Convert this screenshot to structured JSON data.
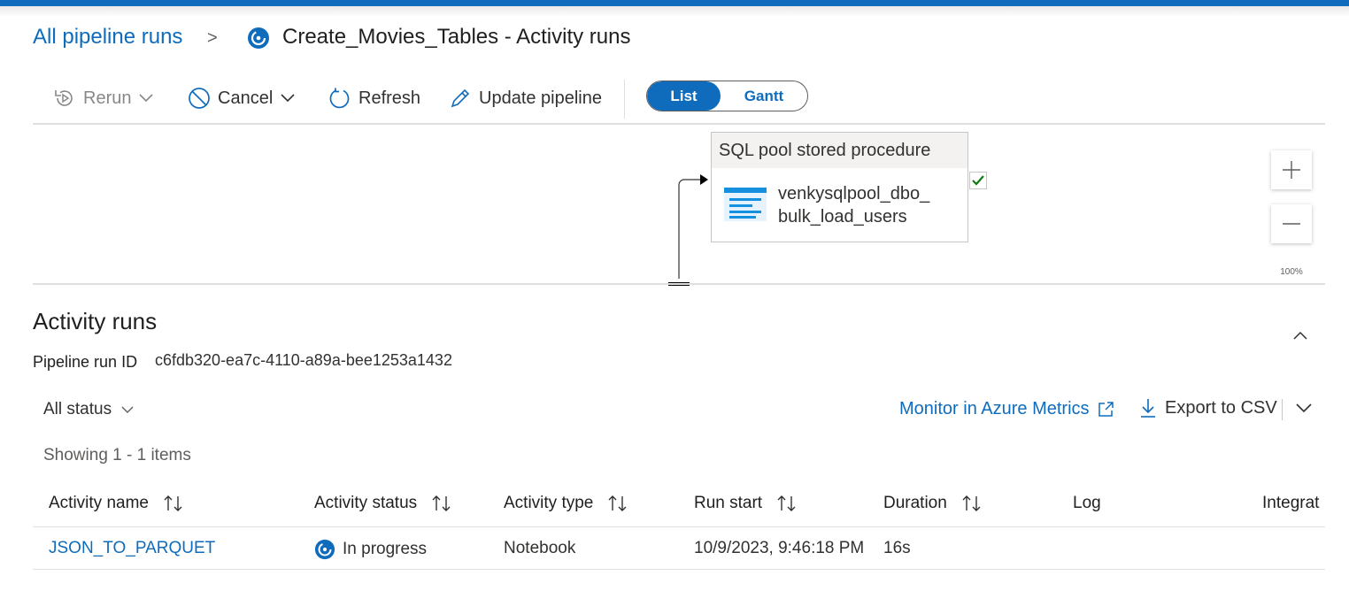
{
  "breadcrumb": {
    "root_link": "All pipeline runs",
    "separator": ">",
    "title": "Create_Movies_Tables - Activity runs",
    "status_icon": "in-progress-icon"
  },
  "toolbar": {
    "rerun_label": "Rerun",
    "cancel_label": "Cancel",
    "refresh_label": "Refresh",
    "update_label": "Update pipeline",
    "view_options": [
      "List",
      "Gantt"
    ],
    "selected_view": "List"
  },
  "canvas": {
    "activity_type_label": "SQL pool stored procedure",
    "activity_name_line1": "venkysqlpool_dbo_",
    "activity_name_line2": "bulk_load_users",
    "status": "succeeded",
    "zoom_fit_label": "100%"
  },
  "activity_runs": {
    "title": "Activity runs",
    "run_id_label": "Pipeline run ID",
    "run_id_value": "c6fdb320-ea7c-4110-a89a-bee1253a1432",
    "status_filter": "All status",
    "monitor_link": "Monitor in Azure Metrics",
    "export_label": "Export to CSV",
    "showing_text": "Showing 1 - 1 items",
    "columns": [
      "Activity name",
      "Activity status",
      "Activity type",
      "Run start",
      "Duration",
      "Log",
      "Integrat"
    ],
    "rows": [
      {
        "activity_name": "JSON_TO_PARQUET",
        "activity_status": "In progress",
        "activity_type": "Notebook",
        "run_start": "10/9/2023, 9:46:18 PM",
        "duration": "16s",
        "log": "",
        "integration": ""
      }
    ]
  },
  "colors": {
    "accent": "#0f6cbd",
    "success": "#107c10",
    "text": "#323130"
  }
}
